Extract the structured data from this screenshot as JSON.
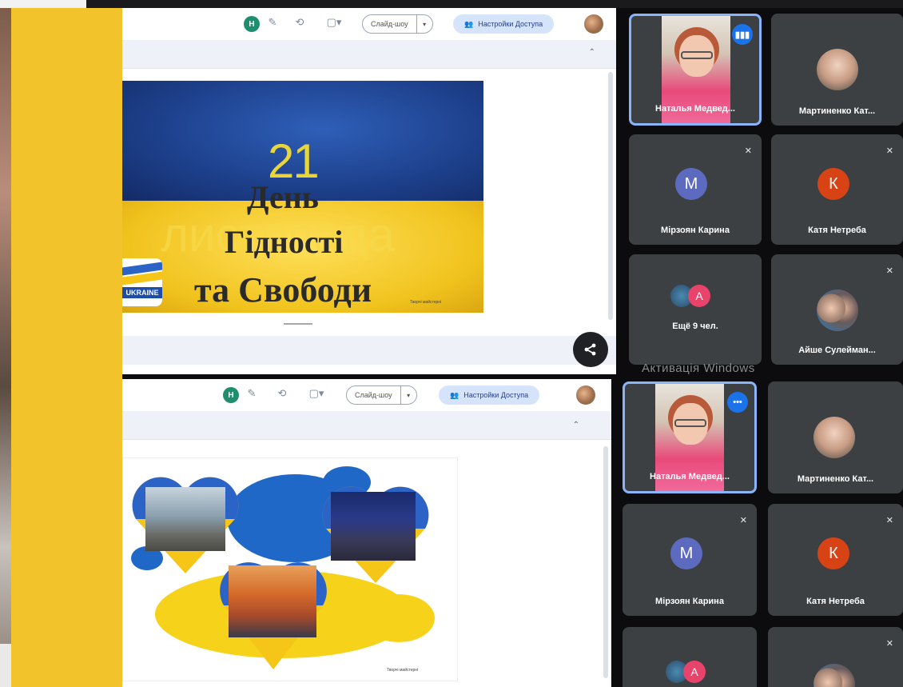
{
  "pane1": {
    "avatar_letter": "Н",
    "slideshow_label": "Слайд-шоу",
    "access_label": "Настройки Доступа",
    "slide": {
      "number": "21",
      "month": "листопада",
      "line1": "День",
      "line2": "Гідності",
      "line3": "та Свободи",
      "logo_text": "UKRAINE",
      "credit": "Творчі майстерні"
    }
  },
  "pane2": {
    "avatar_letter": "Н",
    "slideshow_label": "Слайд-шоу",
    "access_label": "Настройки Доступа",
    "credit": "Творчі майстерні"
  },
  "participants_top": [
    {
      "name": "Наталья Медвед...",
      "type": "video",
      "speaking": true
    },
    {
      "name": "Мартиненко Кат...",
      "type": "photo"
    },
    {
      "name": "Мірзоян Карина",
      "type": "letter",
      "letter": "M",
      "color": "#5c6bc0",
      "muted": true
    },
    {
      "name": "Катя Нетреба",
      "type": "letter",
      "letter": "К",
      "color": "#d84315",
      "muted": true
    },
    {
      "name": "Ещё 9 чел.",
      "type": "more",
      "letter": "A"
    },
    {
      "name": "Айше Сулейман...",
      "type": "photo",
      "muted": true
    }
  ],
  "participants_bottom": [
    {
      "name": "Наталья Медвед...",
      "type": "video",
      "more": true
    },
    {
      "name": "Мартиненко Кат...",
      "type": "photo"
    },
    {
      "name": "Мірзоян Карина",
      "type": "letter",
      "letter": "M",
      "color": "#5c6bc0",
      "muted": true
    },
    {
      "name": "Катя Нетреба",
      "type": "letter",
      "letter": "К",
      "color": "#d84315",
      "muted": true
    },
    {
      "name": "",
      "type": "more",
      "letter": "A"
    },
    {
      "name": "",
      "type": "photo",
      "muted": true
    }
  ],
  "watermark": "Активація Windows",
  "icons": {
    "share": "share-icon",
    "mic_off": "mic-off-icon",
    "speaking": "audio-level-icon",
    "more": "more-options-icon"
  }
}
